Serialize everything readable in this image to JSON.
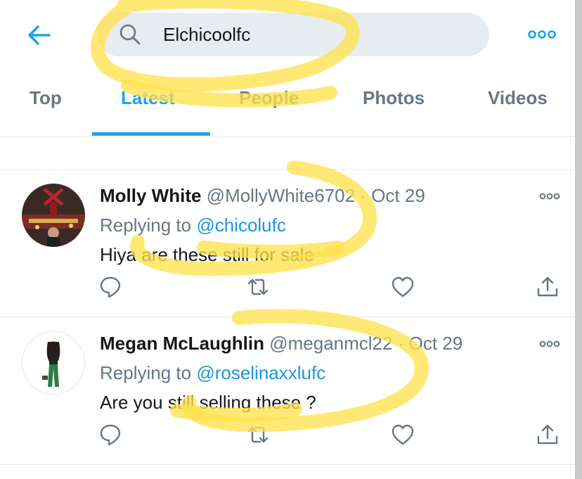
{
  "search": {
    "query": "Elchicoolfc"
  },
  "tabs": [
    {
      "label": "Top"
    },
    {
      "label": "Latest"
    },
    {
      "label": "People"
    },
    {
      "label": "Photos"
    },
    {
      "label": "Videos"
    }
  ],
  "active_tab": "Latest",
  "tweets": [
    {
      "name": "Molly White",
      "handle": "@MollyWhite6702",
      "separator": "·",
      "date": "Oct 29",
      "replying_prefix": "Replying to",
      "replying_to": "@chicolufc",
      "text": "Hiya are these still for sale"
    },
    {
      "name": "Megan McLaughlin",
      "handle": "@meganmcl22",
      "separator": "·",
      "date": "Oct 29",
      "replying_prefix": "Replying to",
      "replying_to": "@roselinaxxlufc",
      "text": "Are you still selling these ?"
    }
  ],
  "colors": {
    "accent": "#1da1f2",
    "secondary_text": "#657786",
    "highlight": "#ffe14d"
  },
  "icons": [
    "back-arrow-icon",
    "search-icon",
    "more-options-icon",
    "reply-icon",
    "retweet-icon",
    "like-icon",
    "share-icon"
  ]
}
